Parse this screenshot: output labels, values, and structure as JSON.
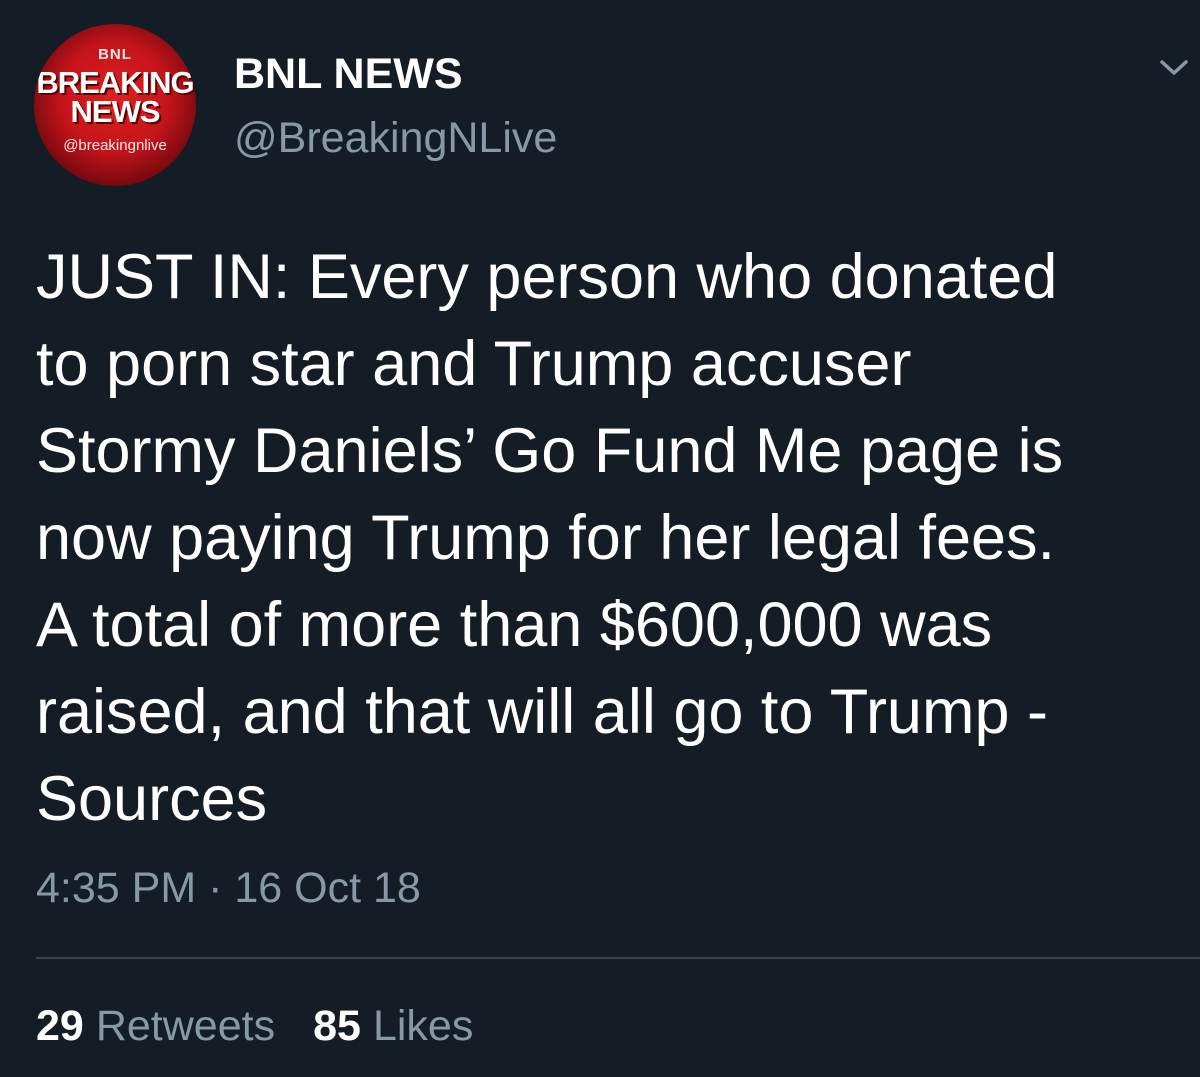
{
  "author": {
    "name": "BNL NEWS",
    "handle": "@BreakingNLive",
    "avatar": {
      "top_text": "BNL",
      "line1": "BREAKING",
      "line2": "NEWS",
      "handle_text": "@breakingnlive"
    }
  },
  "tweet": {
    "text": "JUST IN: Every person who donated\nto porn star and Trump accuser\nStormy Daniels’ Go Fund Me page is\nnow paying Trump for her legal fees.\nA total of more than $600,000 was\nraised, and that will all go to Trump -\nSources",
    "time": "4:35 PM",
    "separator": "·",
    "date": "16 Oct 18"
  },
  "stats": {
    "retweets_count": "29",
    "retweets_label": "Retweets",
    "likes_count": "85",
    "likes_label": "Likes"
  },
  "icons": {
    "menu": "chevron-down-icon"
  },
  "colors": {
    "background": "#141d26",
    "primary_text": "#ffffff",
    "secondary_text": "#8899a6",
    "divider": "#38444d",
    "avatar_red": "#c4141b"
  }
}
